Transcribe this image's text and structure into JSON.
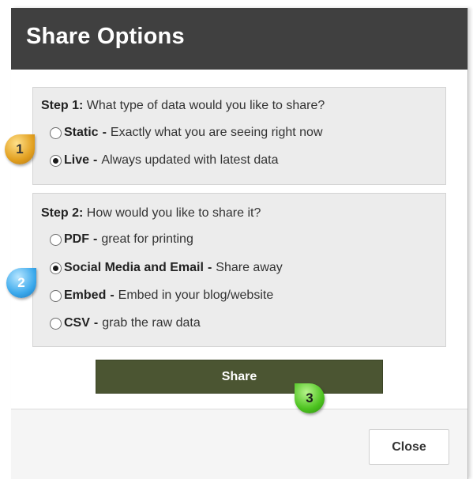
{
  "dialog": {
    "title": "Share Options",
    "step1": {
      "label": "Step 1:",
      "question": "What type of data would you like to share?",
      "options": [
        {
          "name": "Static",
          "desc": "Exactly what you are seeing right now",
          "selected": false
        },
        {
          "name": "Live",
          "desc": "Always updated with latest data",
          "selected": true
        }
      ]
    },
    "step2": {
      "label": "Step 2:",
      "question": "How would you like to share it?",
      "options": [
        {
          "name": "PDF",
          "desc": "great for printing",
          "selected": false
        },
        {
          "name": "Social Media and Email",
          "desc": "Share away",
          "selected": true
        },
        {
          "name": "Embed",
          "desc": "Embed in your blog/website",
          "selected": false
        },
        {
          "name": "CSV",
          "desc": "grab the raw data",
          "selected": false
        }
      ]
    },
    "share_label": "Share",
    "close_label": "Close"
  },
  "callouts": {
    "one": "1",
    "two": "2",
    "three": "3"
  },
  "colors": {
    "header_bg": "#404040",
    "share_button_bg": "#4b5532",
    "callout_1": "#e2a020",
    "callout_2": "#3ba9ec",
    "callout_3": "#4cc21f"
  }
}
